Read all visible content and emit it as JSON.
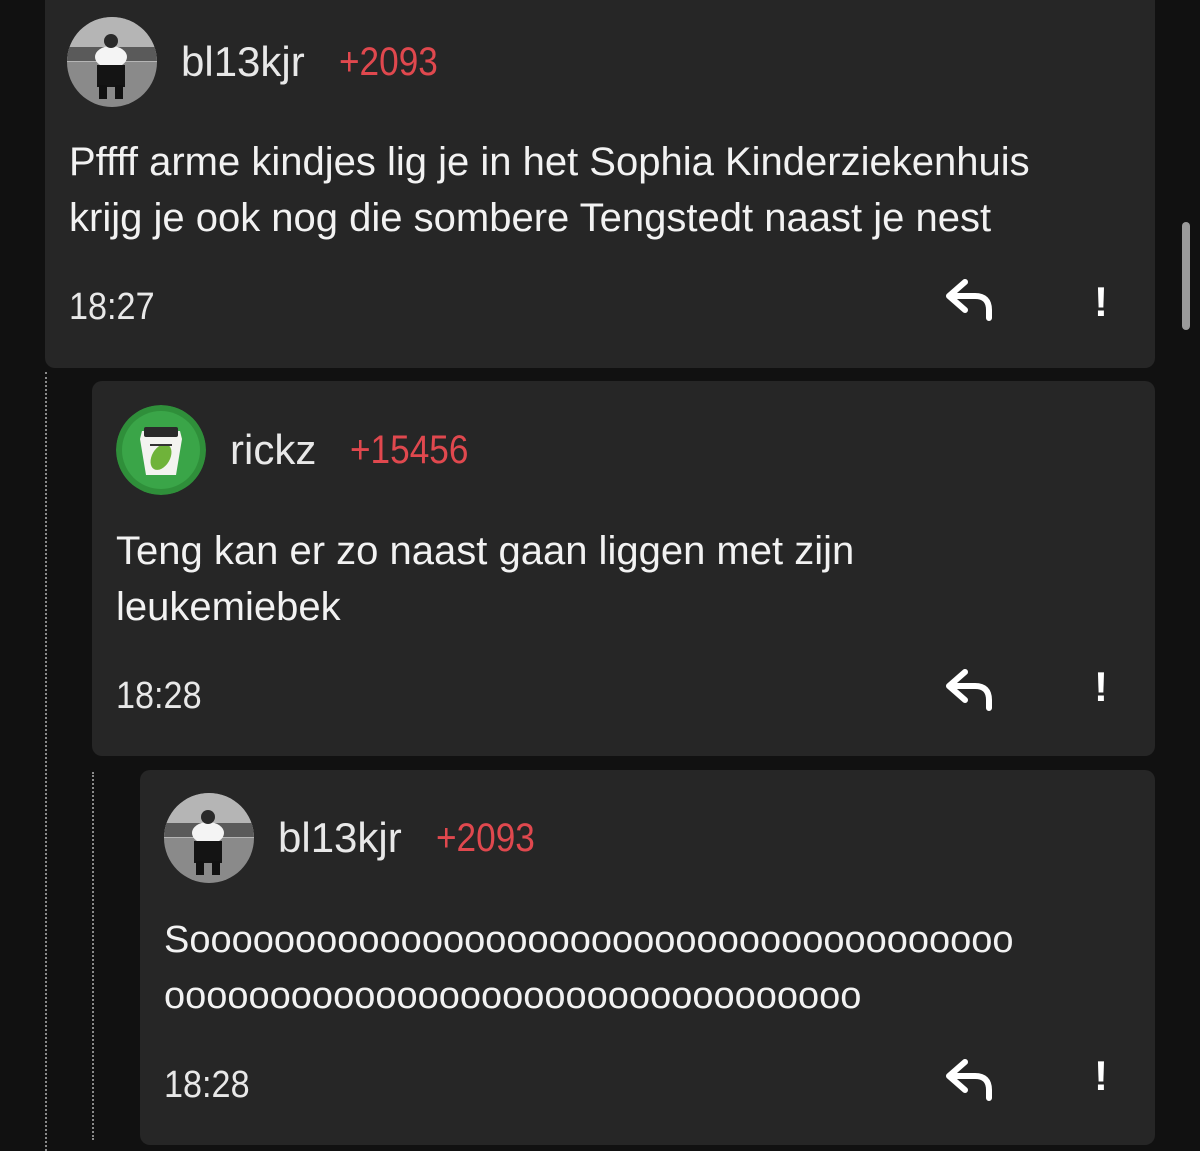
{
  "comments": [
    {
      "username": "bl13kjr",
      "score": "+2093",
      "text": "Pffff arme kindjes lig je in het Sophia Kinderziekenhuis\nkrijg je ook nog die sombere Tengstedt naast je nest",
      "time": "18:27",
      "avatar_icon": "person-avatar-icon"
    },
    {
      "username": "rickz",
      "score": "+15456",
      "text": "Teng kan er zo naast gaan liggen met zijn\nleukemiebek",
      "time": "18:28",
      "avatar_icon": "pickle-jar-avatar-icon"
    },
    {
      "username": "bl13kjr",
      "score": "+2093",
      "text": "Sooooooooooooooooooooooooooooooooooooooo\nooooooooooooooooooooooooooooooooo",
      "time": "18:28",
      "avatar_icon": "person-avatar-icon"
    }
  ],
  "actions": {
    "reply_icon": "reply-arrow-icon",
    "report_label": "!"
  },
  "colors": {
    "background": "#111111",
    "card": "#262626",
    "score": "#e0484e",
    "text": "#f2f2f2"
  }
}
